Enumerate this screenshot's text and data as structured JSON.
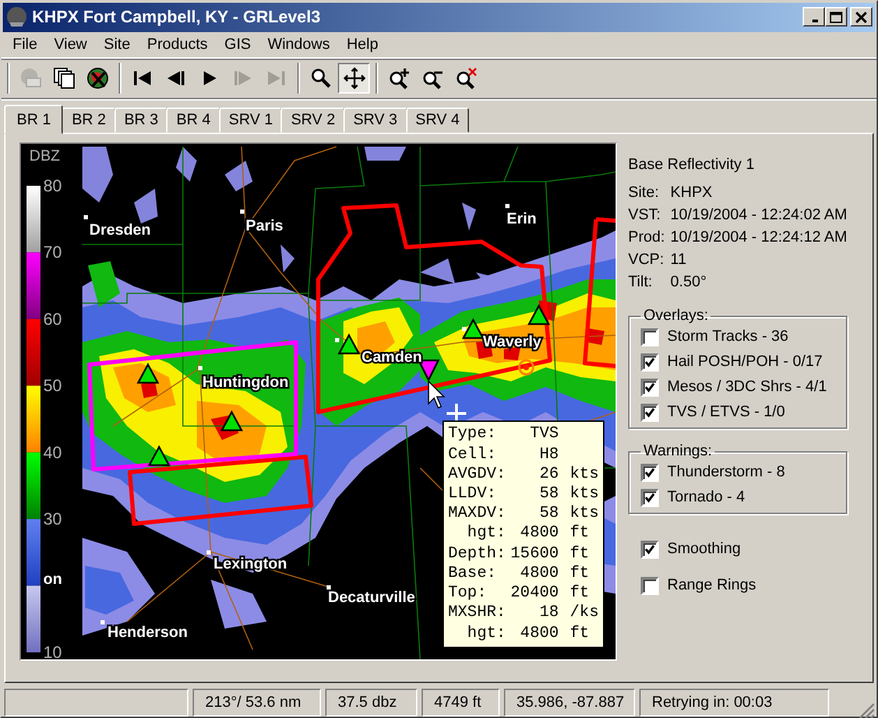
{
  "window": {
    "title": "KHPX Fort Campbell, KY - GRLevel3"
  },
  "menu": [
    "File",
    "View",
    "Site",
    "Products",
    "GIS",
    "Windows",
    "Help"
  ],
  "toolbar": {
    "groups": [
      {
        "buttons": [
          {
            "kind": "copy-image",
            "disabled": true,
            "pressed": false
          },
          {
            "kind": "copy",
            "disabled": false,
            "pressed": false
          },
          {
            "kind": "globe-stop",
            "disabled": false,
            "pressed": false
          }
        ]
      },
      {
        "buttons": [
          {
            "kind": "first",
            "disabled": false,
            "pressed": false
          },
          {
            "kind": "prev",
            "disabled": false,
            "pressed": false
          },
          {
            "kind": "play",
            "disabled": false,
            "pressed": false
          },
          {
            "kind": "next",
            "disabled": true,
            "pressed": false
          },
          {
            "kind": "last",
            "disabled": true,
            "pressed": false
          }
        ]
      },
      {
        "buttons": [
          {
            "kind": "zoom",
            "disabled": false,
            "pressed": false
          },
          {
            "kind": "pan",
            "disabled": false,
            "pressed": true
          }
        ]
      },
      {
        "buttons": [
          {
            "kind": "zoom-in",
            "disabled": false,
            "pressed": false
          },
          {
            "kind": "zoom-out",
            "disabled": false,
            "pressed": false
          },
          {
            "kind": "zoom-reset",
            "disabled": false,
            "pressed": false
          }
        ]
      }
    ]
  },
  "tabs": [
    {
      "label": "BR 1",
      "selected": true
    },
    {
      "label": "BR 2",
      "selected": false
    },
    {
      "label": "BR 3",
      "selected": false
    },
    {
      "label": "BR 4",
      "selected": false
    },
    {
      "label": "SRV 1",
      "selected": false
    },
    {
      "label": "SRV 2",
      "selected": false
    },
    {
      "label": "SRV 3",
      "selected": false
    },
    {
      "label": "SRV 4",
      "selected": false
    }
  ],
  "radar": {
    "legend": {
      "title": "DBZ",
      "ticks": [
        "80",
        "70",
        "60",
        "50",
        "40",
        "30",
        "10"
      ]
    },
    "cities": [
      {
        "name": "Dresden"
      },
      {
        "name": "Paris"
      },
      {
        "name": "Erin"
      },
      {
        "name": "Camden"
      },
      {
        "name": "Waverly"
      },
      {
        "name": "Huntingdon"
      },
      {
        "name": "Lexington"
      },
      {
        "name": "Decaturville"
      },
      {
        "name": "Henderson"
      },
      {
        "name": "on"
      }
    ],
    "tooltip": [
      {
        "label": "Type:",
        "value": "TVS"
      },
      {
        "label": "Cell:",
        "value": "H8"
      },
      {
        "label": "AVGDV:",
        "value": "26",
        "unit": "kts"
      },
      {
        "label": "LLDV:",
        "value": "58",
        "unit": "kts"
      },
      {
        "label": "MAXDV:",
        "value": "58",
        "unit": "kts"
      },
      {
        "label": "  hgt:",
        "value": "4800",
        "unit": "ft"
      },
      {
        "label": "Depth:",
        "value": "15600",
        "unit": "ft"
      },
      {
        "label": "Base:",
        "value": "4800",
        "unit": "ft"
      },
      {
        "label": "Top:",
        "value": "20400",
        "unit": "ft"
      },
      {
        "label": "MXSHR:",
        "value": "18",
        "unit": "/ks"
      },
      {
        "label": "  hgt:",
        "value": "4800",
        "unit": "ft"
      }
    ]
  },
  "info": {
    "title": "Base Reflectivity 1",
    "rows": [
      {
        "label": "Site:",
        "value": "KHPX"
      },
      {
        "label": "VST:",
        "value": "10/19/2004 - 12:24:02 AM"
      },
      {
        "label": "Prod:",
        "value": "10/19/2004 - 12:24:12 AM"
      },
      {
        "label": "VCP:",
        "value": "11"
      },
      {
        "label": "Tilt:",
        "value": "0.50°"
      }
    ]
  },
  "overlays": {
    "title": "Overlays:",
    "items": [
      {
        "label": "Storm Tracks - 36",
        "checked": false
      },
      {
        "label": "Hail POSH/POH - 0/17",
        "checked": true
      },
      {
        "label": "Mesos / 3DC Shrs - 4/1",
        "checked": true
      },
      {
        "label": "TVS / ETVS - 1/0",
        "checked": true
      }
    ]
  },
  "warnings": {
    "title": "Warnings:",
    "items": [
      {
        "label": "Thunderstorm - 8",
        "checked": true
      },
      {
        "label": "Tornado - 4",
        "checked": true
      }
    ]
  },
  "options": [
    {
      "label": "Smoothing",
      "checked": true
    },
    {
      "label": "Range Rings",
      "checked": false
    }
  ],
  "status_bar": [
    "213°/ 53.6 nm",
    "37.5 dbz",
    "4749 ft",
    "35.986, -87.887",
    "Retrying in: 00:03"
  ]
}
